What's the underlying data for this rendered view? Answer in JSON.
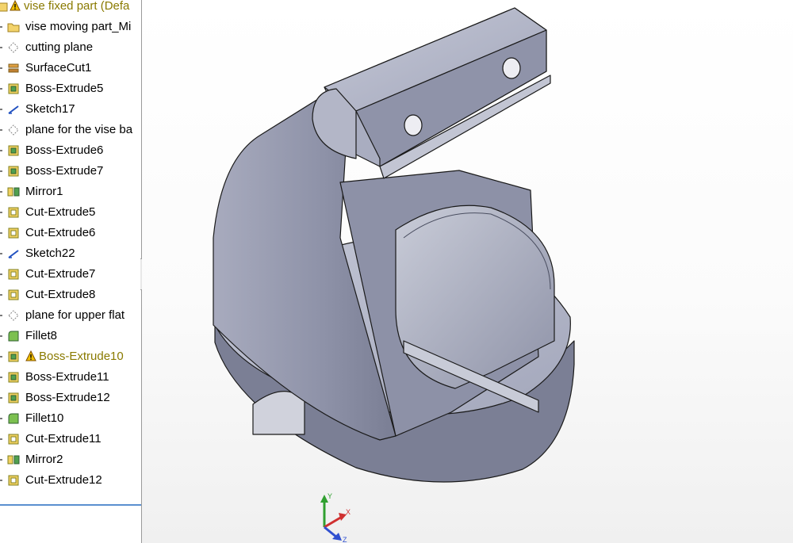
{
  "feature_tree": {
    "items": [
      {
        "label": "vise fixed part  (Defa",
        "icon": "part-folder-icon",
        "warning": true
      },
      {
        "label": "vise moving part_Mi",
        "icon": "folder-icon"
      },
      {
        "label": "cutting plane",
        "icon": "plane-icon"
      },
      {
        "label": "SurfaceCut1",
        "icon": "surface-cut-icon"
      },
      {
        "label": "Boss-Extrude5",
        "icon": "boss-extrude-icon"
      },
      {
        "label": "Sketch17",
        "icon": "sketch-icon"
      },
      {
        "label": "plane for the vise ba",
        "icon": "plane-icon"
      },
      {
        "label": "Boss-Extrude6",
        "icon": "boss-extrude-icon"
      },
      {
        "label": "Boss-Extrude7",
        "icon": "boss-extrude-icon"
      },
      {
        "label": "Mirror1",
        "icon": "mirror-icon"
      },
      {
        "label": "Cut-Extrude5",
        "icon": "cut-extrude-icon"
      },
      {
        "label": "Cut-Extrude6",
        "icon": "cut-extrude-icon"
      },
      {
        "label": "Sketch22",
        "icon": "sketch-icon"
      },
      {
        "label": "Cut-Extrude7",
        "icon": "cut-extrude-icon"
      },
      {
        "label": "Cut-Extrude8",
        "icon": "cut-extrude-icon"
      },
      {
        "label": "plane for upper flat",
        "icon": "plane-icon"
      },
      {
        "label": "Fillet8",
        "icon": "fillet-icon"
      },
      {
        "label": "Boss-Extrude10",
        "icon": "boss-extrude-icon",
        "warning": true
      },
      {
        "label": "Boss-Extrude11",
        "icon": "boss-extrude-icon"
      },
      {
        "label": "Boss-Extrude12",
        "icon": "boss-extrude-icon"
      },
      {
        "label": "Fillet10",
        "icon": "fillet-icon"
      },
      {
        "label": "Cut-Extrude11",
        "icon": "cut-extrude-icon"
      },
      {
        "label": "Mirror2",
        "icon": "mirror-icon"
      },
      {
        "label": "Cut-Extrude12",
        "icon": "cut-extrude-icon"
      }
    ]
  },
  "triad": {
    "x_label": "X",
    "y_label": "Y",
    "z_label": "Z"
  },
  "colors": {
    "model_face_light": "#b9bccb",
    "model_face_mid": "#9a9eb2",
    "model_face_dark": "#6f7389",
    "edge": "#1a1a1a",
    "warning": "#f0c000",
    "axis_x": "#d03030",
    "axis_y": "#30a030",
    "axis_z": "#3050d0"
  }
}
